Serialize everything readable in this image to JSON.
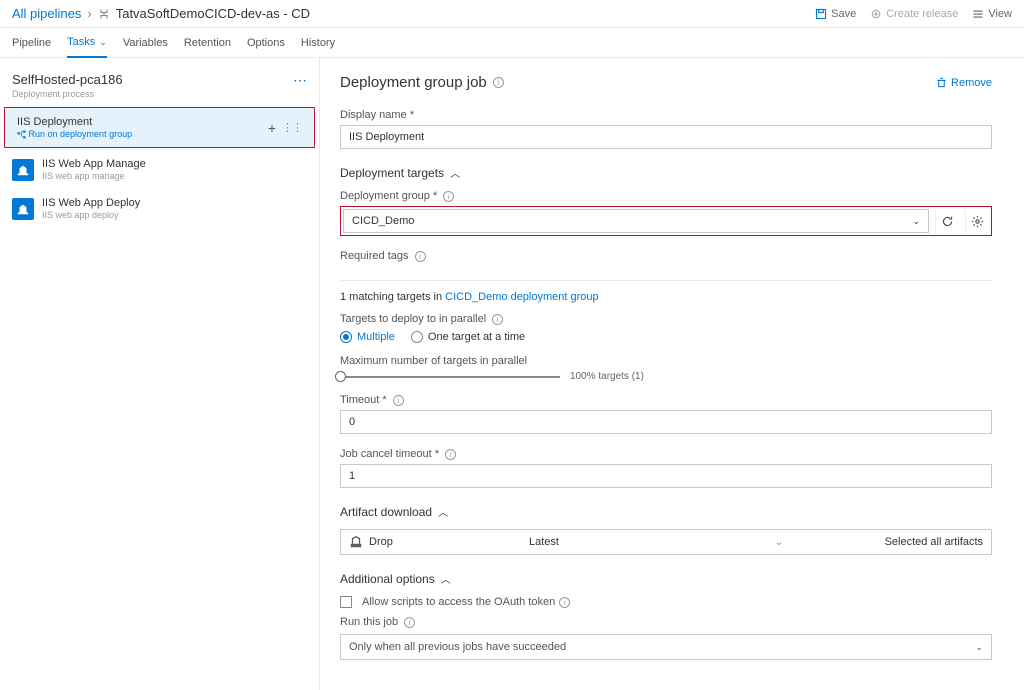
{
  "breadcrumb": {
    "root": "All pipelines",
    "current": "TatvaSoftDemoCICD-dev-as - CD"
  },
  "header_actions": {
    "save": "Save",
    "create_release": "Create release",
    "view": "View"
  },
  "tabs": {
    "pipeline": "Pipeline",
    "tasks": "Tasks",
    "variables": "Variables",
    "retention": "Retention",
    "options": "Options",
    "history": "History"
  },
  "sidebar": {
    "stage": {
      "title": "SelfHosted-pca186",
      "subtitle": "Deployment process"
    },
    "selected": {
      "title": "IIS Deployment",
      "subtitle": "Run on deployment group"
    },
    "tasks": [
      {
        "title": "IIS Web App Manage",
        "subtitle": "IIS web app manage"
      },
      {
        "title": "IIS Web App Deploy",
        "subtitle": "IIS web app deploy"
      }
    ]
  },
  "content": {
    "header": "Deployment group job",
    "remove": "Remove",
    "display_name_label": "Display name *",
    "display_name_value": "IIS Deployment",
    "deployment_targets_title": "Deployment targets",
    "deployment_group_label": "Deployment group *",
    "deployment_group_value": "CICD_Demo",
    "required_tags_label": "Required tags",
    "matching_text_prefix": "1 matching targets in ",
    "matching_link": "CICD_Demo deployment group",
    "targets_parallel_label": "Targets to deploy to in parallel",
    "radio_multiple": "Multiple",
    "radio_one": "One target at a time",
    "max_parallel_label": "Maximum number of targets in parallel",
    "slider_value_text": "100% targets (1)",
    "timeout_label": "Timeout *",
    "timeout_value": "0",
    "job_cancel_label": "Job cancel timeout *",
    "job_cancel_value": "1",
    "artifact_title": "Artifact download",
    "artifact_col_name": "Drop",
    "artifact_col_latest": "Latest",
    "artifact_selected_text": "Selected all artifacts",
    "additional_title": "Additional options",
    "oauth_label": "Allow scripts to access the OAuth token",
    "run_job_label": "Run this job",
    "run_job_value": "Only when all previous jobs have succeeded"
  }
}
